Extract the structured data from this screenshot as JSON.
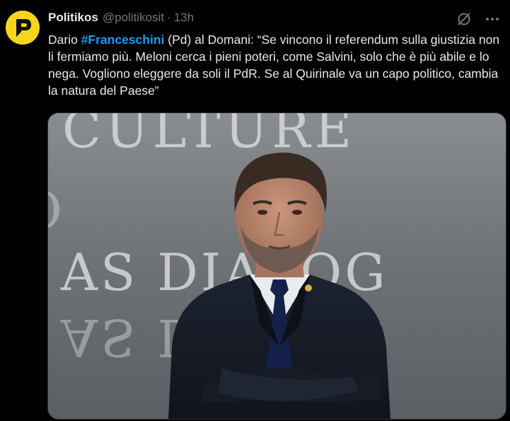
{
  "tweet": {
    "author": {
      "name": "Politikos",
      "handle": "@politikosit",
      "avatar_icon": "politikos-logo-icon",
      "avatar_color": "#f7d51d"
    },
    "separator": "·",
    "time": "13h",
    "text": {
      "prefix": "Dario ",
      "hashtag": "#Franceschini",
      "suffix": " (Pd) al Domani: “Se vincono il referendum sulla giustizia non li fermiamo più. Meloni cerca i pieni poteri, come Salvini, solo che è più abile e lo nega. Vogliono eleggere da soli il PdR. Se al Quirinale va un capo politico, cambia la natura del Paese”"
    },
    "actions": {
      "grok_icon": "grok-icon",
      "more_icon": "more-options-icon"
    },
    "media": {
      "type": "photo",
      "background_lines": [
        "CULTURE",
        "CULTURE",
        "AS DIALOG",
        "AS DIALOG"
      ]
    }
  },
  "colors": {
    "background": "#000000",
    "text_primary": "#e7e9ea",
    "text_secondary": "#71767b",
    "link": "#1d9bf0"
  }
}
